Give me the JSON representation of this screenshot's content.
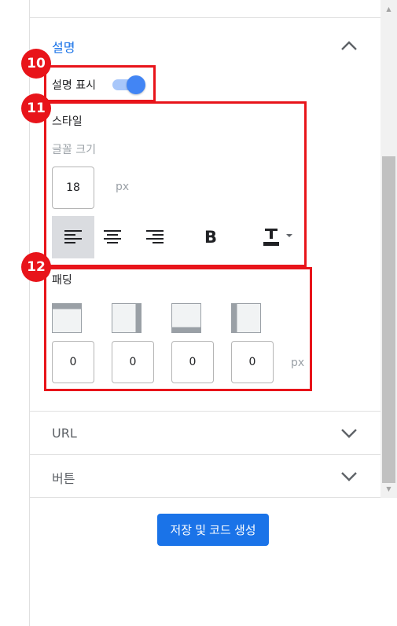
{
  "sections": {
    "description": {
      "title": "설명",
      "show_label": "설명 표시",
      "show_on": true
    },
    "url": {
      "title": "URL"
    },
    "button": {
      "title": "버튼"
    }
  },
  "style": {
    "title": "스타일",
    "font_size_label": "글꼴 크기",
    "font_size_value": "18",
    "unit": "px",
    "toolbar": [
      "align-left",
      "align-center",
      "align-right",
      "bold",
      "text-color"
    ],
    "bold_glyph": "B",
    "active_align": "align-left"
  },
  "padding": {
    "title": "패딩",
    "values": [
      "0",
      "0",
      "0",
      "0"
    ],
    "unit": "px",
    "sides": [
      "top",
      "right",
      "bottom",
      "left"
    ]
  },
  "save_button": "저장 및 코드 생성",
  "annotations": [
    "10",
    "11",
    "12"
  ],
  "colors": {
    "accent": "#1a73e8",
    "annotation": "#e8141a",
    "toggle": "#4285f4"
  }
}
